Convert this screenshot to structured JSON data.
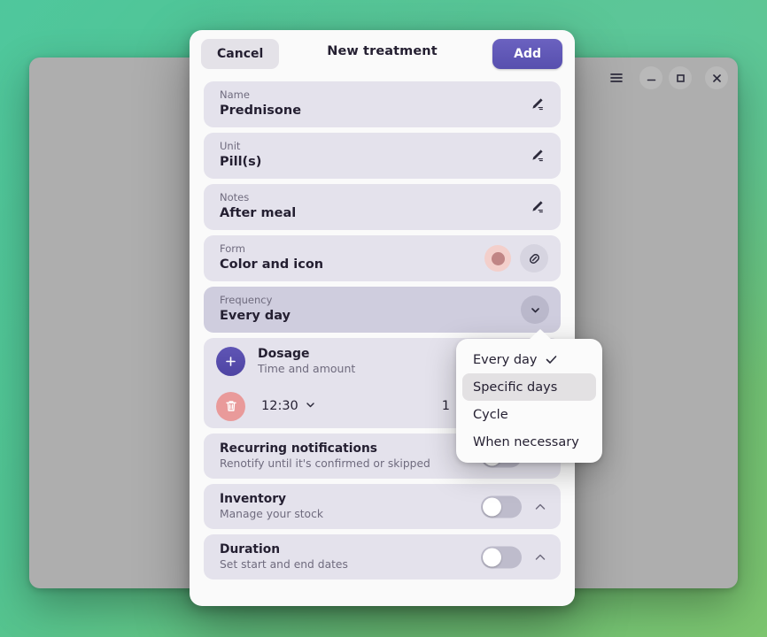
{
  "desktop": {
    "background_color": "#4cc48e"
  },
  "background_window": {
    "title_bar": {
      "menu_icon": "hamburger-menu-icon",
      "minimize_icon": "minimize-icon",
      "maximize_icon": "maximize-icon",
      "close_icon": "close-icon"
    }
  },
  "dialog": {
    "title": "New treatment",
    "cancel_label": "Cancel",
    "add_label": "Add",
    "accent_color": "#574fae",
    "fields": [
      {
        "label": "Name",
        "value": "Prednisone",
        "icon": "pencil-edit-icon"
      },
      {
        "label": "Unit",
        "value": "Pill(s)",
        "icon": "pencil-edit-icon"
      },
      {
        "label": "Notes",
        "value": "After meal",
        "icon": "pencil-edit-icon"
      }
    ],
    "form_row": {
      "label": "Form",
      "value": "Color and icon",
      "swatch_color": "#c08585",
      "swatch_bg_color": "#f3cfcb",
      "icon": "pill-capsule-icon"
    },
    "frequency_row": {
      "label": "Frequency",
      "value": "Every day",
      "dropdown_icon": "chevron-down-icon"
    },
    "dosage": {
      "title": "Dosage",
      "subtitle": "Time and amount",
      "add_icon": "plus-icon",
      "entries": [
        {
          "delete_icon": "trash-icon",
          "time": "12:30",
          "time_chevron_icon": "chevron-down-icon",
          "amount": "1"
        }
      ]
    },
    "expanders": [
      {
        "title": "Recurring notifications",
        "subtitle": "Renotify until it's confirmed or skipped",
        "toggle_on": false,
        "chevron_icon": "chevron-up-icon"
      },
      {
        "title": "Inventory",
        "subtitle": "Manage your stock",
        "toggle_on": false,
        "chevron_icon": "chevron-up-icon"
      },
      {
        "title": "Duration",
        "subtitle": "Set start and end dates",
        "toggle_on": false,
        "chevron_icon": "chevron-up-icon"
      }
    ]
  },
  "frequency_popover": {
    "items": [
      {
        "label": "Every day",
        "checked": true,
        "highlighted": false
      },
      {
        "label": "Specific days",
        "checked": false,
        "highlighted": true
      },
      {
        "label": "Cycle",
        "checked": false,
        "highlighted": false
      },
      {
        "label": "When necessary",
        "checked": false,
        "highlighted": false
      }
    ]
  }
}
